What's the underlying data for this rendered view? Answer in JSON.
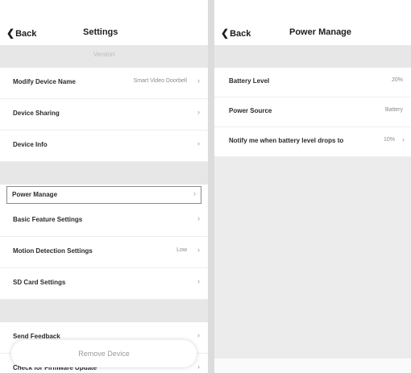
{
  "settings": {
    "back_label": "Back",
    "title": "Settings",
    "top_band_text": "Version",
    "rows": [
      {
        "label": "Modify Device Name",
        "value": "Smart Video Doorbell"
      },
      {
        "label": "Device Sharing",
        "value": ""
      },
      {
        "label": "Device Info",
        "value": ""
      },
      {
        "label": "Power Manage",
        "value": ""
      },
      {
        "label": "Basic Feature Settings",
        "value": ""
      },
      {
        "label": "Motion Detection Settings",
        "value": "Low"
      },
      {
        "label": "SD Card Settings",
        "value": ""
      },
      {
        "label": "Send Feedback",
        "value": ""
      },
      {
        "label": "Check for Firmware Update",
        "value": ""
      }
    ],
    "remove_label": "Remove Device"
  },
  "power": {
    "back_label": "Back",
    "title": "Power Manage",
    "rows": [
      {
        "label": "Battery Level",
        "value": "20%"
      },
      {
        "label": "Power Source",
        "value": "Battery"
      },
      {
        "label": "Notify me when battery level drops to",
        "value": "10%"
      }
    ]
  }
}
